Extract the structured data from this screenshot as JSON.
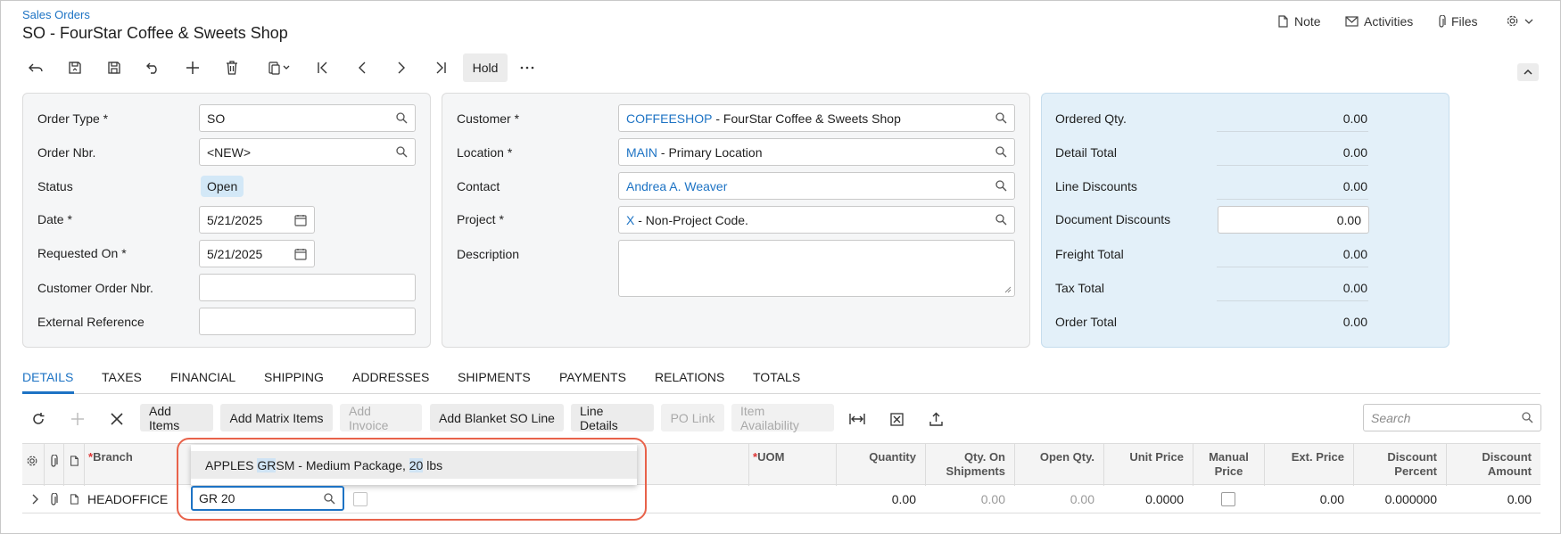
{
  "header": {
    "breadcrumb": "Sales Orders",
    "title": "SO - FourStar Coffee & Sweets Shop",
    "actions": {
      "note": "Note",
      "activities": "Activities",
      "files": "Files"
    }
  },
  "toolbar": {
    "hold_label": "Hold"
  },
  "order_panel": {
    "order_type_label": "Order Type",
    "order_type_value": "SO",
    "order_nbr_label": "Order Nbr.",
    "order_nbr_value": "<NEW>",
    "status_label": "Status",
    "status_value": "Open",
    "date_label": "Date",
    "date_value": "5/21/2025",
    "requested_on_label": "Requested On",
    "requested_on_value": "5/21/2025",
    "customer_order_nbr_label": "Customer Order Nbr.",
    "external_reference_label": "External Reference",
    "required_mark": "*"
  },
  "customer_panel": {
    "customer_label": "Customer",
    "customer_id": "COFFEESHOP",
    "customer_name": " - FourStar Coffee & Sweets Shop",
    "location_label": "Location",
    "location_id": "MAIN",
    "location_name": " - Primary Location",
    "contact_label": "Contact",
    "contact_value": "Andrea A. Weaver",
    "project_label": "Project",
    "project_id": "X",
    "project_name": " - Non-Project Code.",
    "description_label": "Description"
  },
  "totals_panel": {
    "ordered_qty_label": "Ordered Qty.",
    "ordered_qty": "0.00",
    "detail_total_label": "Detail Total",
    "detail_total": "0.00",
    "line_discounts_label": "Line Discounts",
    "line_discounts": "0.00",
    "document_discounts_label": "Document Discounts",
    "document_discounts": "0.00",
    "freight_total_label": "Freight Total",
    "freight_total": "0.00",
    "tax_total_label": "Tax Total",
    "tax_total": "0.00",
    "order_total_label": "Order Total",
    "order_total": "0.00"
  },
  "tabs": [
    "DETAILS",
    "TAXES",
    "FINANCIAL",
    "SHIPPING",
    "ADDRESSES",
    "SHIPMENTS",
    "PAYMENTS",
    "RELATIONS",
    "TOTALS"
  ],
  "grid_toolbar": {
    "add_items": "Add Items",
    "add_matrix_items": "Add Matrix Items",
    "add_invoice": "Add Invoice",
    "add_blanket_so_line": "Add Blanket SO Line",
    "line_details": "Line Details",
    "po_link": "PO Link",
    "item_availability": "Item Availability",
    "search_placeholder": "Search"
  },
  "grid": {
    "headers": {
      "branch": "Branch",
      "uom": "UOM",
      "quantity": "Quantity",
      "qty_on_shipments_1": "Qty. On",
      "qty_on_shipments_2": "Shipments",
      "open_qty": "Open Qty.",
      "unit_price": "Unit Price",
      "manual_price_1": "Manual",
      "manual_price_2": "Price",
      "ext_price": "Ext. Price",
      "discount_percent_1": "Discount",
      "discount_percent_2": "Percent",
      "discount_amount_1": "Discount",
      "discount_amount_2": "Amount",
      "required_mark": "*"
    },
    "row": {
      "branch": "HEADOFFICE",
      "inventory_input": "GR 20",
      "quantity": "0.00",
      "qty_on_shipments": "0.00",
      "open_qty": "0.00",
      "unit_price": "0.0000",
      "ext_price": "0.00",
      "discount_percent": "0.000000",
      "discount_amount": "0.00"
    }
  },
  "autocomplete": {
    "part1": "APPLES ",
    "match1": "GR",
    "part2": "SM - Medium Package, ",
    "match2": "20",
    "part3": " lbs"
  }
}
